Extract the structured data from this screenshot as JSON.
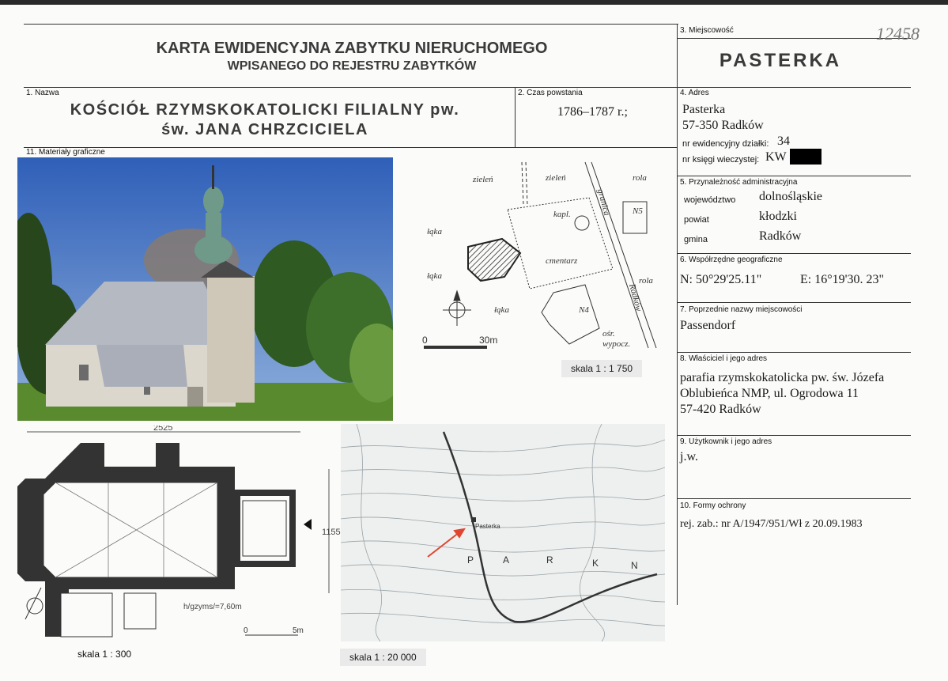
{
  "inventory_number": "12458",
  "header": {
    "line1": "KARTA EWIDENCYJNA ZABYTKU NIERUCHOMEGO",
    "line2": "WPISANEGO DO REJESTRU ZABYTKÓW"
  },
  "field3": {
    "label": "3. Miejscowość",
    "value": "PASTERKA"
  },
  "field1": {
    "label": "1. Nazwa",
    "line1": "KOŚCIÓŁ RZYMSKOKATOLICKI FILIALNY pw.",
    "line2": "św. JANA CHRZCICIELA"
  },
  "field2": {
    "label": "2. Czas powstania",
    "value": "1786–1787 r.;"
  },
  "field4": {
    "label": "4. Adres",
    "line1": "Pasterka",
    "line2": "57-350 Radków",
    "plot_label": "nr ewidencyjny działki:",
    "plot_value": "34",
    "register_label": "nr księgi wieczystej:",
    "register_value": "KW"
  },
  "field5": {
    "label": "5. Przynależność administracyjna",
    "rows": [
      {
        "k": "województwo",
        "v": "dolnośląskie"
      },
      {
        "k": "powiat",
        "v": "kłodzki"
      },
      {
        "k": "gmina",
        "v": "Radków"
      }
    ]
  },
  "field6": {
    "label": "6. Współrzędne geograficzne",
    "n": "N:  50°29'25.11\"",
    "e": "E: 16°19'30. 23\""
  },
  "field7": {
    "label": "7. Poprzednie nazwy miejscowości",
    "value": "Passendorf"
  },
  "field8": {
    "label": "8. Właściciel i jego adres",
    "line1": "parafia rzymskokatolicka pw. św. Józefa",
    "line2": "Oblubieńca NMP, ul. Ogrodowa 11",
    "line3": "57-420 Radków"
  },
  "field9": {
    "label": "9. Użytkownik i jego adres",
    "value": "j.w."
  },
  "field10": {
    "label": "10. Formy ochrony",
    "value": "rej. zab.: nr A/1947/951/Wł z 20.09.1983"
  },
  "field11": {
    "label": "11. Materiały graficzne"
  },
  "site_plan": {
    "labels": [
      "zieleń",
      "zieleń",
      "rola",
      "kapl.",
      "łąka",
      "cmentarz",
      "łąka",
      "rola",
      "łąka",
      "N5",
      "N4",
      "granica",
      "Radków",
      "ośr.",
      "wypocz."
    ],
    "scale_bar": "30m",
    "scale_zero": "0",
    "scale": "skala 1 : 1 750"
  },
  "floor_plan": {
    "width_dim": "2525",
    "height_dim": "1155",
    "height_note": "h/gzyms/=7,60m",
    "scale_bar": "5m",
    "scale_zero": "0",
    "scale": "skala 1 : 300"
  },
  "topo_map": {
    "village": "Pasterka",
    "park_letters": [
      "P",
      "A",
      "R",
      "K",
      "N"
    ],
    "scale": "skala 1 : 20 000"
  },
  "colors": {
    "sky": "#3f6fc0",
    "roof": "#a9aeb8",
    "wall": "#d8d3c9",
    "tree": "#2f5a22",
    "grass": "#5a8a2e",
    "arrow": "#e0452f"
  }
}
